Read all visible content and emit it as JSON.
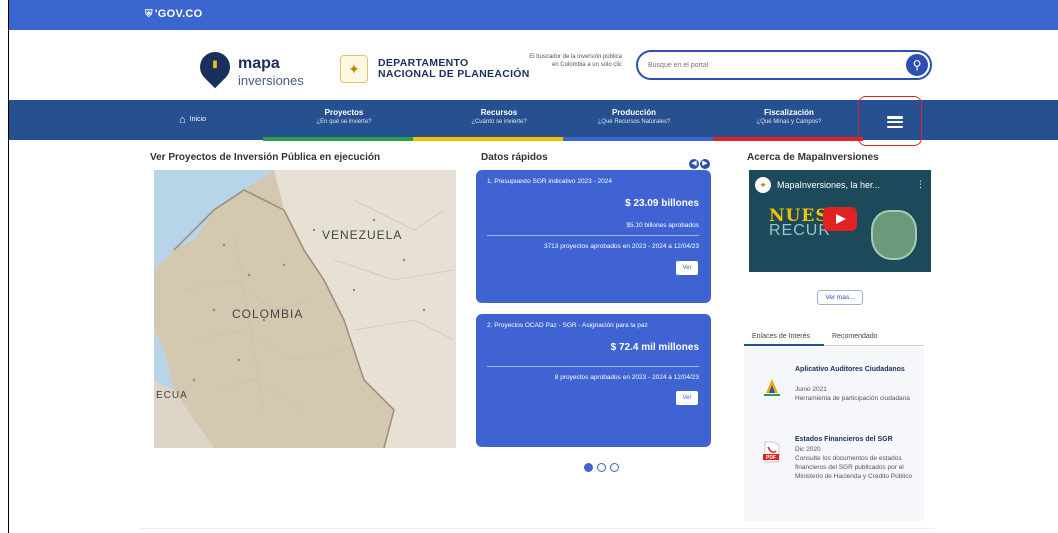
{
  "govbar": {
    "label": "GOV.CO",
    "shield_icon": "shield-icon"
  },
  "header": {
    "logo_line1": "mapa",
    "logo_line2": "inversiones",
    "dnp_line1": "DEPARTAMENTO",
    "dnp_line2": "NACIONAL DE PLANEACIÓN",
    "tagline": "El buscador de la inversión pública en Colombia a un solo clic",
    "search_placeholder": "Busque en el portal"
  },
  "nav": {
    "home_label": "Inicio",
    "items": [
      {
        "label": "Proyectos",
        "sub": "¿En qué se invierte?"
      },
      {
        "label": "Recursos",
        "sub": "¿Cuánto se invierte?"
      },
      {
        "label": "Producción",
        "sub": "¿Qué Recursos Naturales?"
      },
      {
        "label": "Fiscalización",
        "sub": "¿Qué Minas y Campos?"
      }
    ],
    "stripe_colors": [
      "#2a9d4a",
      "#f2c100",
      "#3c66cf",
      "#e02222"
    ]
  },
  "map_section": {
    "title": "Ver Proyectos de Inversión Pública en ejecución",
    "labels": [
      "VENEZUELA",
      "COLOMBIA",
      "ECUA"
    ]
  },
  "datos": {
    "title": "Datos rápidos",
    "cards": [
      {
        "header": "1. Presupuesto SGR indicativo 2023 - 2024",
        "big": "$ 23.09 billones",
        "small": "$5.10 billones aprobados",
        "projects": "3713 proyectos aprobados en 2023 - 2024 a 12/04/23",
        "button": "Ver"
      },
      {
        "header": "2. Proyectos OCAD Paz - SGR - Asignación para la paz",
        "big": "$ 72.4 mil millones",
        "projects": "8 proyectos aprobados en 2023 - 2024 a 12/04/23",
        "button": "Ver"
      }
    ]
  },
  "acerca": {
    "title": "Acerca de MapaInversiones",
    "video_title": "MapaInversiones, la her...",
    "video_word1": "NUEST",
    "video_word2": "RECUR",
    "ver_mas": "Ver mas...",
    "tabs": [
      "Enlaces de Interés",
      "Recomendado"
    ],
    "links": [
      {
        "title": "Aplicativo Auditores Ciudadanos",
        "date": "Junio 2021",
        "desc": "Herramienta de participación ciudadana"
      },
      {
        "title": "Estados Financieros del SGR",
        "date": "Dic 2020",
        "desc": "Consulte los documentos de estados financieros del SGR publicados por el Ministerio de Hacienda y Crédito Público",
        "badge": "PDF"
      }
    ]
  },
  "colors": {
    "gov_blue": "#3c66cf",
    "nav_blue": "#26508f",
    "card_blue": "#3f63d3",
    "highlight_red": "#e02222"
  }
}
